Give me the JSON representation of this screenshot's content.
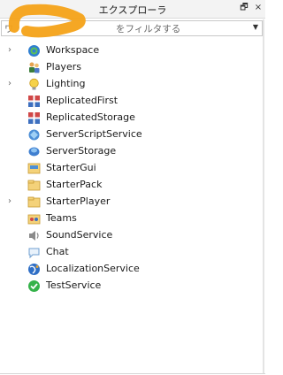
{
  "window": {
    "title": "エクスプローラ",
    "restore_glyph": "🗗",
    "close_glyph": "×"
  },
  "filter": {
    "value": "ワ　　　　　　　　　　　をフィルタする"
  },
  "tree": [
    {
      "label": "Workspace",
      "icon": "workspace-icon",
      "expandable": true
    },
    {
      "label": "Players",
      "icon": "players-icon",
      "expandable": false
    },
    {
      "label": "Lighting",
      "icon": "lighting-icon",
      "expandable": true
    },
    {
      "label": "ReplicatedFirst",
      "icon": "replicated-first-icon",
      "expandable": false
    },
    {
      "label": "ReplicatedStorage",
      "icon": "replicated-storage-icon",
      "expandable": false
    },
    {
      "label": "ServerScriptService",
      "icon": "server-script-service-icon",
      "expandable": false
    },
    {
      "label": "ServerStorage",
      "icon": "server-storage-icon",
      "expandable": false
    },
    {
      "label": "StarterGui",
      "icon": "starter-gui-icon",
      "expandable": false
    },
    {
      "label": "StarterPack",
      "icon": "starter-pack-icon",
      "expandable": false
    },
    {
      "label": "StarterPlayer",
      "icon": "starter-player-icon",
      "expandable": true
    },
    {
      "label": "Teams",
      "icon": "teams-icon",
      "expandable": false
    },
    {
      "label": "SoundService",
      "icon": "sound-service-icon",
      "expandable": false
    },
    {
      "label": "Chat",
      "icon": "chat-icon",
      "expandable": false
    },
    {
      "label": "LocalizationService",
      "icon": "localization-service-icon",
      "expandable": false
    },
    {
      "label": "TestService",
      "icon": "test-service-icon",
      "expandable": false
    }
  ],
  "colors": {
    "overlay_orange": "#f5a31b"
  }
}
